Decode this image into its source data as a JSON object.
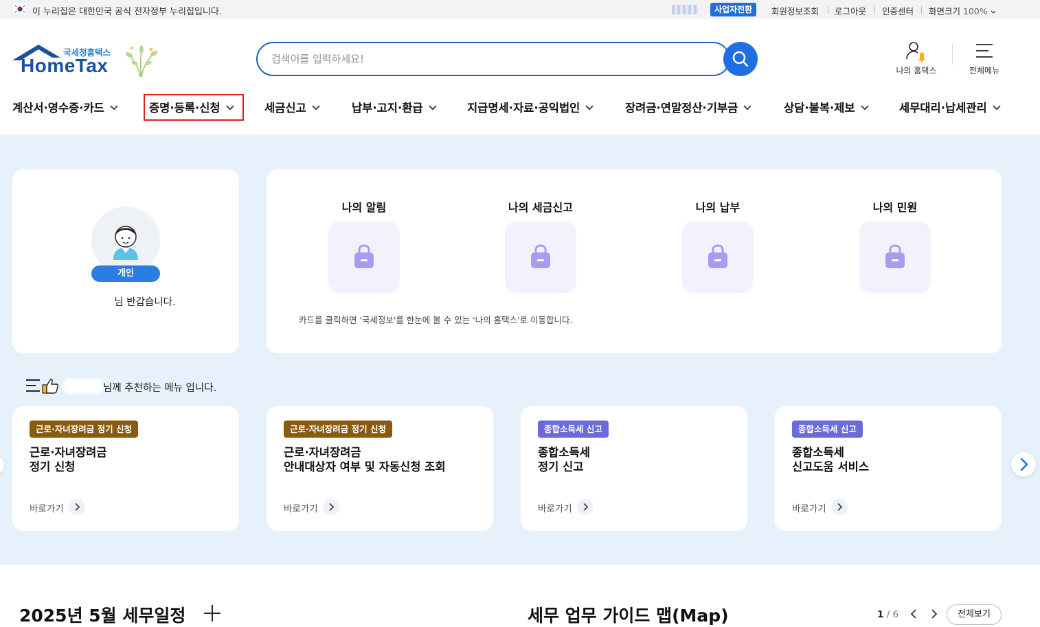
{
  "gov_bar": {
    "notice": "이 누리집은 대한민국 공식 전자정부 누리집입니다.",
    "business_switch": "사업자전환",
    "member_info": "회원정보조회",
    "logout": "로그아웃",
    "cert_center": "인증센터",
    "screen_size_label": "화면크기",
    "screen_size_value": "100%"
  },
  "logo": {
    "small": "국세청홈택스",
    "big": "HomeTax"
  },
  "search": {
    "placeholder": "검색어를 입력하세요!"
  },
  "header_tools": {
    "my_hometax": "나의 홈택스",
    "all_menu": "전체메뉴"
  },
  "gnb": [
    "계산서·영수증·카드",
    "증명·등록·신청",
    "세금신고",
    "납부·고지·환급",
    "지급명세·자료·공익법인",
    "장려금·연말정산·기부금",
    "상담·불복·제보",
    "세무대리·납세관리"
  ],
  "profile": {
    "type": "개인",
    "greeting": "님 반갑습니다."
  },
  "my_items": [
    "나의 알림",
    "나의 세금신고",
    "나의 납부",
    "나의 민원"
  ],
  "my_note": "카드를 클릭하면 '국세정보'를 한눈에 볼 수 있는 '나의 홈택스'로 이동합니다.",
  "recommend_text": "님께 추천하는 메뉴 입니다.",
  "rec_cards": [
    {
      "tag": "근로·자녀장려금 정기 신청",
      "title1": "근로·자녀장려금",
      "title2": "정기 신청",
      "go": "바로가기"
    },
    {
      "tag": "근로·자녀장려금 정기 신청",
      "title1": "근로·자녀장려금",
      "title2": "안내대상자 여부 및 자동신청 조회",
      "go": "바로가기"
    },
    {
      "tag": "종합소득세 신고",
      "title1": "종합소득세",
      "title2": "정기 신고",
      "go": "바로가기"
    },
    {
      "tag": "종합소득세 신고",
      "title1": "종합소득세",
      "title2": "신고도움 서비스",
      "go": "바로가기"
    }
  ],
  "schedule_title": "2025년 5월 세무일정",
  "guide_title": "세무 업무 가이드 맵(Map)",
  "pager": {
    "current": "1",
    "total": "/ 6"
  },
  "view_all": "전체보기"
}
